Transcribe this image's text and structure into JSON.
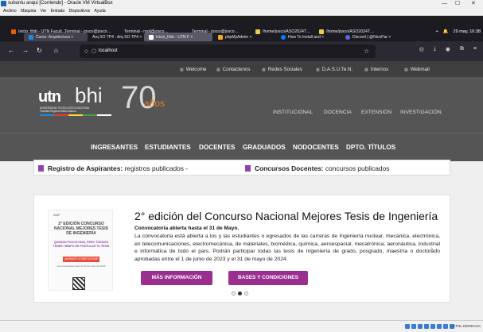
{
  "vbox": {
    "title": "subuntu anqui [Corriendo] - Oracle VM VirtualBox",
    "menu": [
      "Archivo",
      "Máquina",
      "Ver",
      "Entrada",
      "Dispositivos",
      "Ayuda"
    ],
    "host_key": "CTRL DERECHA"
  },
  "browser": {
    "tabs": [
      {
        "label": "Inicio_frbb - UTN Facult…",
        "color": "#e66000"
      },
      {
        "label": "Curso: Arquitectura ×",
        "color": "#1e88e5"
      },
      {
        "label": "Terminal - josco@josco…",
        "color": "#444"
      },
      {
        "label": "Terminal - root@josco…",
        "color": "#444"
      },
      {
        "label": "Terminal - josco@josco…",
        "color": "#444"
      },
      {
        "label": "/home/josco/ASO2024T…",
        "color": "#f2c94c"
      },
      {
        "label": "/home/josco/ASO2024T…",
        "color": "#f2c94c"
      }
    ],
    "clock": "29 may, 16:38",
    "open_tabs": [
      {
        "label": "Curso: Arquitectura ×",
        "color": "#1e88e5"
      },
      {
        "label": "Arq SO TP4 - Arq SO TP4 ×",
        "color": "#888"
      },
      {
        "label": "inicio_frbb - UTN F ×",
        "color": "#fff"
      },
      {
        "label": "phpMyAdmin ×",
        "color": "#f5a623"
      },
      {
        "label": "How To Install and ×",
        "color": "#0080ff"
      },
      {
        "label": "Discord | @NicoPar ×",
        "color": "#5865f2"
      }
    ],
    "url": "localhost"
  },
  "site": {
    "toplinks": [
      "Welcome",
      "Contactenos",
      "Redes Sociales",
      "D.A.S.U.Te.N.",
      "Internos",
      "Webmail"
    ],
    "logo": {
      "utn": "utn",
      "bhi": "bhi",
      "line1": "UNIVERSIDAD TECNOLÓGICA NACIONAL",
      "line2": "Facultad Regional Bahía Blanca",
      "seventy": "70",
      "anos": "años"
    },
    "banner_nav": [
      "INSTITUCIONAL",
      "DOCENCIA",
      "EXTENSIÓN",
      "INVESTIGACIÓN"
    ],
    "main_nav": [
      "INGRESANTES",
      "ESTUDIANTES",
      "DOCENTES",
      "GRADUADOS",
      "NODOCENTES",
      "DPTO. TÍTULOS"
    ],
    "info": [
      {
        "label": "Registro de Aspirantes:",
        "text": " registros publicados -"
      },
      {
        "label": "Concursos Docentes:",
        "text": " concursos publicados"
      }
    ],
    "feature": {
      "heading": "2° edición del Concurso Nacional Mejores Tesis de Ingeniería",
      "subtitle": "Convocatoria abierta hasta el 31 de Mayo.",
      "body": "La convocatoria está abierta a los y las estudiantes o egresados de las carreras de Ingeniería nuclear, mecánica, electrónica, en telecomunicaciones, electromecánica, de materiales, biomédica, química, aeroespacial, mecatrónica, aeronáutica, industrial e informática de todo el país. Podrán participar todas las tesis de Ingeniería de grado, posgrado, maestría o doctorado aprobadas entre el 1 de junio de 2023 y el 31 de mayo de 2024.",
      "btn1": "MÁS INFORMACIÓN",
      "btn2": "BASES Y CONDICIONES",
      "poster": {
        "logo": "INAP",
        "title": "2° EDICIÓN CONCURSO NACIONAL MEJORES TESIS DE INGENIERÍA",
        "mid": "QUEDAN POCOS DÍAS, PERO TODAVÍA TENÉS TIEMPO DE POSTULAR TU TESIS",
        "badge": "¡ANÍMATE A PARTICIPAR!",
        "note": "La convocatoria cierra el 31 de mayo de 2024"
      }
    },
    "carousel": {
      "count": 3,
      "active": 1
    }
  }
}
